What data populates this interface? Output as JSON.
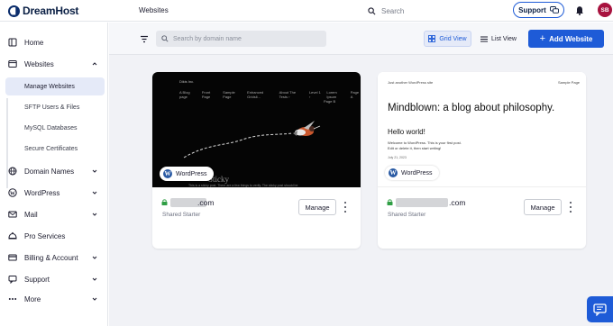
{
  "header": {
    "brand": "DreamHost",
    "page_title": "Websites",
    "search_placeholder": "Search",
    "support_label": "Support",
    "avatar_initials": "SB"
  },
  "sidebar": {
    "items": [
      {
        "label": "Home",
        "icon": "home-icon"
      },
      {
        "label": "Websites",
        "icon": "browser-icon",
        "expanded": true
      },
      {
        "label": "Domain Names",
        "icon": "globe-icon"
      },
      {
        "label": "WordPress",
        "icon": "wordpress-icon"
      },
      {
        "label": "Mail",
        "icon": "mail-icon"
      },
      {
        "label": "Pro Services",
        "icon": "pro-services-icon"
      },
      {
        "label": "Billing & Account",
        "icon": "credit-card-icon"
      },
      {
        "label": "Support",
        "icon": "support-icon"
      },
      {
        "label": "More",
        "icon": "more-icon"
      }
    ],
    "sub_items": [
      {
        "label": "Manage Websites",
        "active": true
      },
      {
        "label": "SFTP Users & Files"
      },
      {
        "label": "MySQL Databases"
      },
      {
        "label": "Secure Certificates"
      }
    ]
  },
  "toolbar": {
    "domain_search_placeholder": "Search by domain name",
    "grid_view_label": "Grid View",
    "list_view_label": "List View",
    "add_website_label": "Add Website"
  },
  "cards": [
    {
      "badge": "WordPress",
      "domain_tld": ".com",
      "plan": "Shared Starter",
      "manage_label": "Manage",
      "preview": {
        "site_name": "Dikis Inc.",
        "menu": [
          "A Blog page",
          "Front Page",
          "Sample Page",
          "Enhanced Gridsli...",
          "About The Tests ›",
          "Level 1 ›",
          "Lorem Ipsum",
          "Page A"
        ],
        "page_b": "Page B",
        "post_title": "Sticky",
        "post_text": "This is a sticky post. There are a few things to verify. The sticky post should be"
      }
    },
    {
      "badge": "WordPress",
      "domain_tld": ".com",
      "plan": "Shared Starter",
      "manage_label": "Manage",
      "preview": {
        "tagline": "Just another WordPress site",
        "sample_page": "Sample Page",
        "title": "Mindblown: a blog about philosophy.",
        "post_title": "Hello world!",
        "body_1": "Welcome to WordPress. This is your first post.",
        "body_2": "Edit or delete it, then start writing!",
        "date": "July 21, 2023"
      }
    }
  ],
  "colors": {
    "accent": "#1e5bd7",
    "brand_navy": "#0a1f44",
    "avatar": "#a8123e",
    "active_nav_bg": "#e5eaf8"
  }
}
